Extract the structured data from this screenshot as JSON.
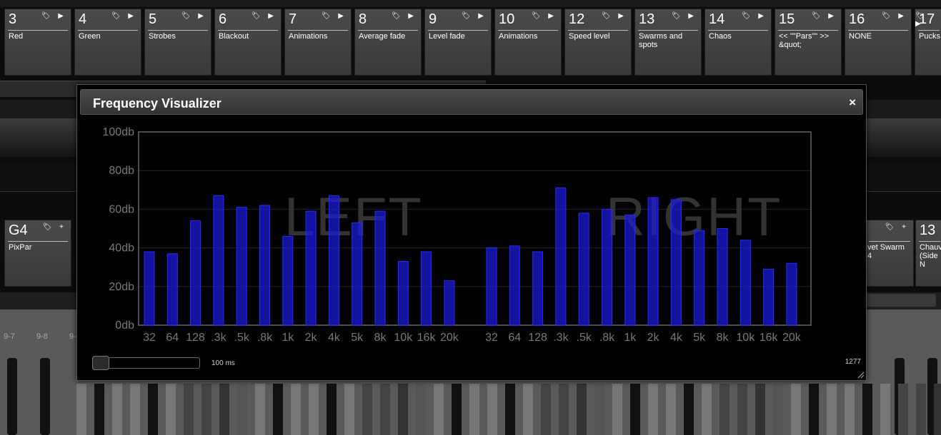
{
  "cue_buttons": [
    {
      "num": "3",
      "label": "Red"
    },
    {
      "num": "4",
      "label": "Green"
    },
    {
      "num": "5",
      "label": "Strobes"
    },
    {
      "num": "6",
      "label": "Blackout"
    },
    {
      "num": "7",
      "label": "Animations"
    },
    {
      "num": "8",
      "label": "Average fade"
    },
    {
      "num": "9",
      "label": "Level fade"
    },
    {
      "num": "10",
      "label": "Animations"
    },
    {
      "num": "12",
      "label": "Speed level"
    },
    {
      "num": "13",
      "label": "Swarms and spots"
    },
    {
      "num": "14",
      "label": "Chaos"
    },
    {
      "num": "15",
      "label": "<< \"\"Pars\"\" >> &quot;"
    },
    {
      "num": "16",
      "label": "NONE"
    },
    {
      "num": "17",
      "label": "Pucks"
    }
  ],
  "group_buttons": [
    {
      "num": "G4",
      "label": "PixPar"
    },
    {
      "num": "",
      "label": "vet Swarm 4"
    },
    {
      "num": "13",
      "label": "Chauv (Side N"
    }
  ],
  "fader_labels": [
    "9-7",
    "9-8",
    "9-"
  ],
  "icons": {
    "tag": "tag-icon",
    "play": "play-icon",
    "plus": "plus-icon",
    "close": "close-icon"
  },
  "dialog": {
    "title": "Frequency Visualizer",
    "close_label": "×",
    "interval_label": "100 ms",
    "interval_fraction": 0.0,
    "counter": "1277"
  },
  "chart_data": {
    "type": "bar",
    "ylabels": [
      "100db",
      "80db",
      "60db",
      "40db",
      "20db",
      "0db"
    ],
    "ylim": [
      0,
      100
    ],
    "grid": true,
    "bar_color": "#1a1adc",
    "annotations": [
      "LEFT",
      "RIGHT"
    ],
    "categories": [
      "32",
      "64",
      "128",
      ".3k",
      ".5k",
      ".8k",
      "1k",
      "2k",
      "4k",
      "5k",
      "8k",
      "10k",
      "16k",
      "20k"
    ],
    "series": [
      {
        "name": "LEFT",
        "values": [
          38,
          37,
          54,
          67,
          61,
          62,
          46,
          59,
          67,
          53,
          59,
          33,
          38,
          23
        ]
      },
      {
        "name": "RIGHT",
        "values": [
          40,
          41,
          38,
          71,
          58,
          60,
          57,
          66,
          65,
          49,
          50,
          44,
          29,
          32
        ]
      }
    ]
  }
}
